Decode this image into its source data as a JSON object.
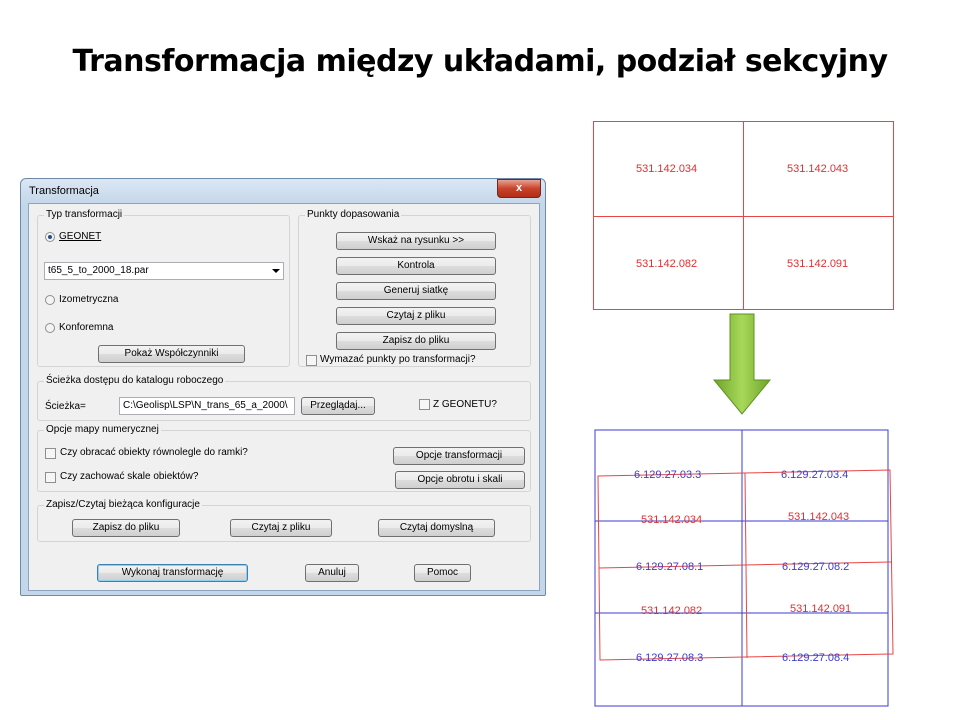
{
  "slide": {
    "title": "Transformacja między układami, podział sekcyjny"
  },
  "dialog": {
    "title": "Transformacja",
    "close_glyph": "x",
    "typ": {
      "label": "Typ transformacji",
      "geonet_label": "GEONET",
      "geonet_selected": true,
      "par_file": "t65_5_to_2000_18.par",
      "izometryczna_label": "Izometryczna",
      "konforemna_label": "Konforemna",
      "wspolczynniki_button": "Pokaż Współczynniki"
    },
    "punkty": {
      "label": "Punkty dopasowania",
      "buttons": [
        "Wskaż na rysunku >>",
        "Kontrola",
        "Generuj siatkę",
        "Czytaj z pliku",
        "Zapisz do pliku"
      ],
      "wymazac_label": "Wymazać punkty po transformacji?"
    },
    "sciezka": {
      "label": "Ścieżka dostępu do katalogu roboczego",
      "field_label": "Ścieżka=",
      "value": "C:\\Geolisp\\LSP\\N_trans_65_a_2000\\",
      "browse_button": "Przeglądaj...",
      "zgeonetu_label": "Z GEONETU?"
    },
    "opcje": {
      "label": "Opcje mapy numerycznej",
      "obracac_label": "Czy obracać obiekty równolegle do ramki?",
      "skale_label": "Czy zachować skale obiektów?",
      "transformacji_button": "Opcje transformacji",
      "obrotu_button": "Opcje obrotu i skali"
    },
    "konfig": {
      "label": "Zapisz/Czytaj bieżąca konfiguracje",
      "zapisz_button": "Zapisz do pliku",
      "czytaj_button": "Czytaj z pliku",
      "domyslna_button": "Czytaj domyslną"
    },
    "footer": {
      "wykonaj_button": "Wykonaj transformację",
      "anuluj_button": "Anuluj",
      "pomoc_button": "Pomoc"
    }
  },
  "grid_before": {
    "cells": [
      "531.142.034",
      "531.142.043",
      "531.142.082",
      "531.142.091"
    ],
    "line_color": "#e84545"
  },
  "grid_after": {
    "blue_labels": [
      "6.129.27.03.3",
      "6.129.27.03.4",
      "6.129.27.08.1",
      "6.129.27.08.2",
      "6.129.27.08.3",
      "6.129.27.08.4"
    ],
    "red_labels": [
      "531.142.034",
      "531.142.043",
      "531.142.082",
      "531.142.091"
    ],
    "blue_color": "#3b3bd4",
    "red_color": "#e84545"
  },
  "colors": {
    "arrow_green": "#8bc53f"
  }
}
